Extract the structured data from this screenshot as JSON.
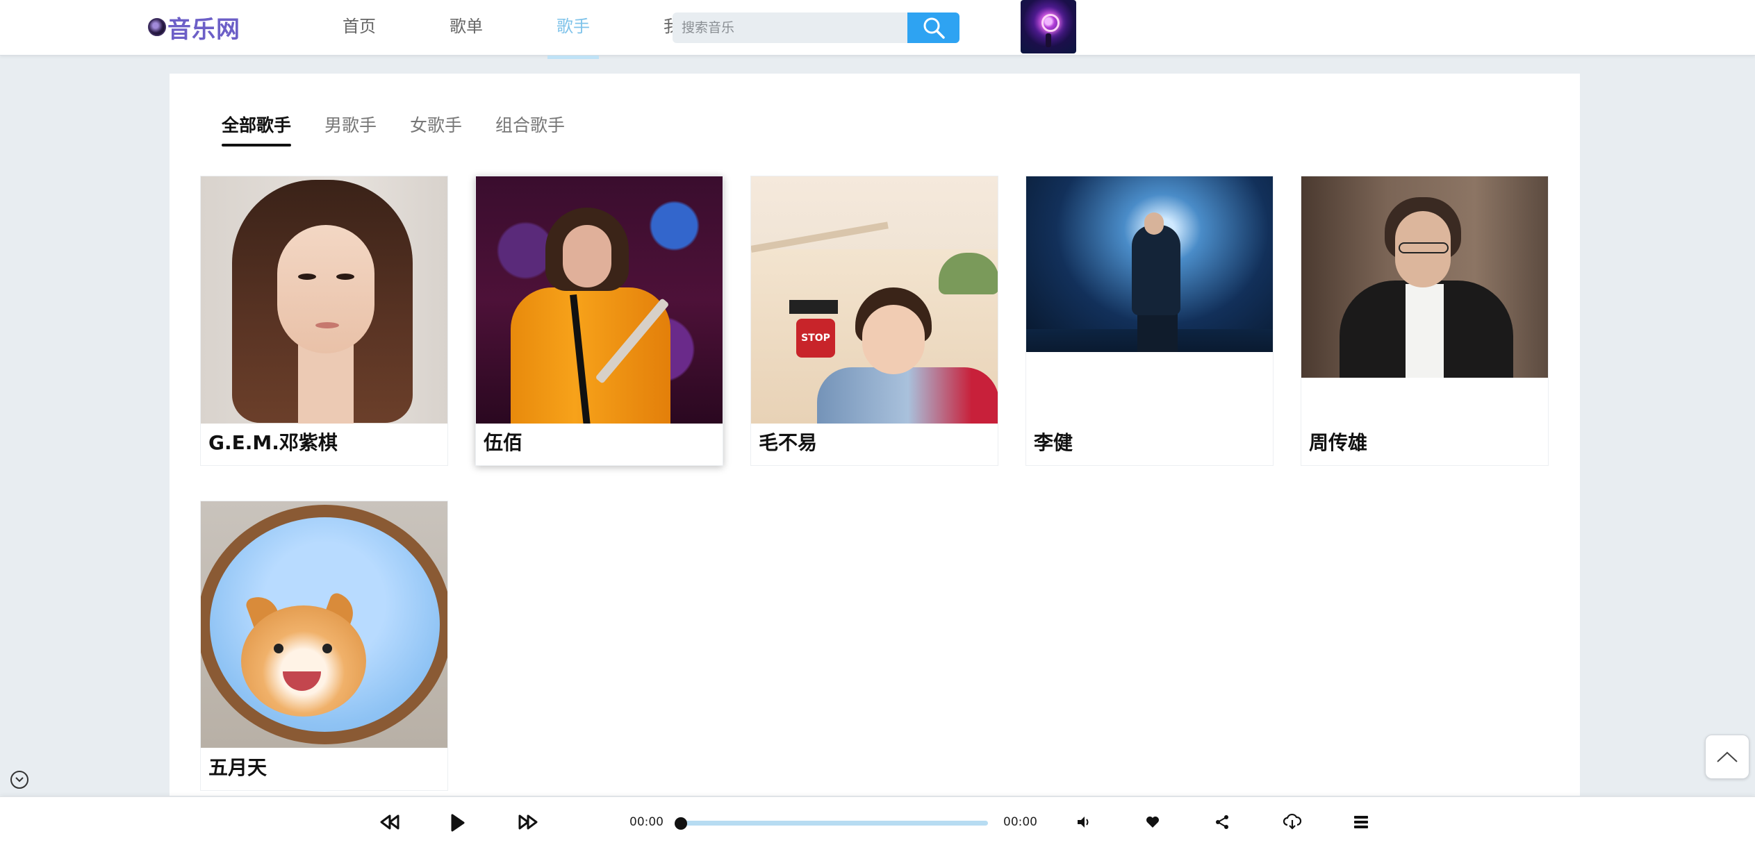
{
  "header": {
    "logo_text": "音乐网",
    "nav": [
      {
        "label": "首页",
        "active": false
      },
      {
        "label": "歌单",
        "active": false
      },
      {
        "label": "歌手",
        "active": true
      },
      {
        "label": "我的音乐",
        "active": false
      }
    ],
    "search": {
      "placeholder": "搜索音乐",
      "value": "",
      "button_icon": "search-icon"
    },
    "user_avatar_icon": "user-avatar"
  },
  "filter_tabs": [
    {
      "label": "全部歌手",
      "active": true
    },
    {
      "label": "男歌手",
      "active": false
    },
    {
      "label": "女歌手",
      "active": false
    },
    {
      "label": "组合歌手",
      "active": false
    }
  ],
  "singers": [
    {
      "name": "G.E.M.邓紫棋"
    },
    {
      "name": "伍佰"
    },
    {
      "name": "毛不易"
    },
    {
      "name": "李健"
    },
    {
      "name": "周传雄"
    },
    {
      "name": "五月天"
    }
  ],
  "side": {
    "collapse_icon": "chevron-down-circle-icon",
    "back_to_top_icon": "chevron-up-icon"
  },
  "player": {
    "current_time": "00:00",
    "total_time": "00:00",
    "progress": 0,
    "controls": [
      "prev-icon",
      "play-icon",
      "next-icon",
      "volume-icon",
      "heart-icon",
      "share-icon",
      "download-icon",
      "playlist-icon"
    ]
  },
  "colors": {
    "accent": "#2ea3f2",
    "logo": "#6c5fc7",
    "active_nav": "#7fc3ea",
    "progress_track": "#b7dcf2"
  }
}
